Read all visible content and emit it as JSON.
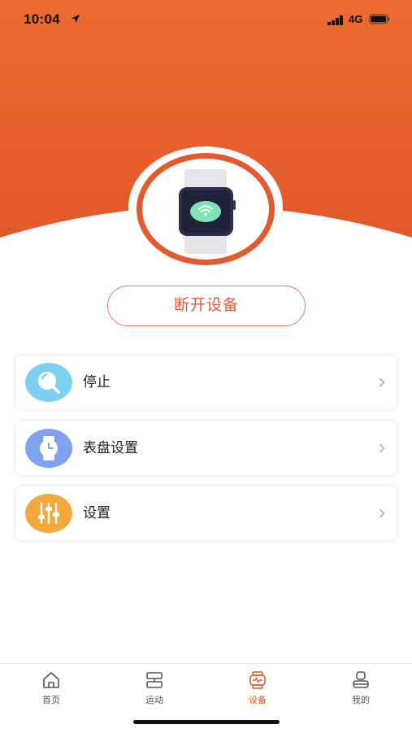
{
  "status": {
    "time": "10:04",
    "network": "4G"
  },
  "device": {
    "disconnect_label": "断开设备"
  },
  "menu": [
    {
      "label": "停止",
      "icon": "search-bubble-icon",
      "color": "#7ed0f2"
    },
    {
      "label": "表盘设置",
      "icon": "watch-icon",
      "color": "#7fa2ef"
    },
    {
      "label": "设置",
      "icon": "sliders-icon",
      "color": "#f2a93b"
    }
  ],
  "tabs": [
    {
      "label": "首页",
      "icon": "home-icon"
    },
    {
      "label": "运动",
      "icon": "sport-icon"
    },
    {
      "label": "设备",
      "icon": "device-icon",
      "active": true
    },
    {
      "label": "我的",
      "icon": "profile-icon"
    }
  ],
  "colors": {
    "accent": "#e45a30",
    "header_top": "#e8662f",
    "header_bottom": "#e35a2a"
  }
}
